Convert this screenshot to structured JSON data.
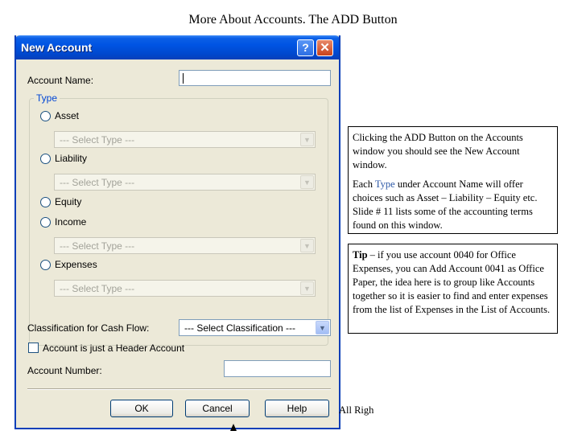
{
  "slide": {
    "title": "More About Accounts. The ADD Button",
    "footer_fragment": "All Righ"
  },
  "dialog": {
    "title": "New Account",
    "help_glyph": "?",
    "close_glyph": "✕",
    "account_name_label": "Account Name:",
    "account_name_value": "",
    "type_group_label": "Type",
    "types": [
      {
        "label": "Asset",
        "select_placeholder": "--- Select Type ---"
      },
      {
        "label": "Liability",
        "select_placeholder": "--- Select Type ---"
      },
      {
        "label": "Equity"
      },
      {
        "label": "Income",
        "select_placeholder": "--- Select Type ---"
      },
      {
        "label": "Expenses",
        "select_placeholder": "--- Select Type ---"
      }
    ],
    "cash_flow_label": "Classification for Cash Flow:",
    "cash_flow_value": "--- Select Classification ---",
    "header_checkbox_label": "Account is just a Header Account",
    "account_number_label": "Account Number:",
    "account_number_value": "",
    "buttons": {
      "ok": "OK",
      "cancel": "Cancel",
      "help": "Help"
    }
  },
  "callouts": {
    "first": {
      "para1": "Clicking the ADD Button on the Accounts window you should see the New Account window.",
      "para2_before": "Each ",
      "para2_highlight": "Type",
      "para2_after": " under Account Name will offer choices such as Asset – Liability – Equity etc. Slide # 11 lists some of the accounting terms found on this window."
    },
    "tip": {
      "label": "Tip",
      "text": " – if you use account 0040 for Office Expenses, you can Add Account 0041 as Office Paper, the idea here is to group like Accounts together so it is easier to find and enter expenses from the list of Expenses in the List of Accounts."
    }
  },
  "colors": {
    "titlebar": "#0054e3",
    "dialog_bg": "#ece9d8",
    "group_label": "#0046d5",
    "highlight_text": "#2e5aa8"
  },
  "icons": {
    "help": "question-mark-icon",
    "close": "close-icon",
    "dropdown": "chevron-down-icon"
  }
}
